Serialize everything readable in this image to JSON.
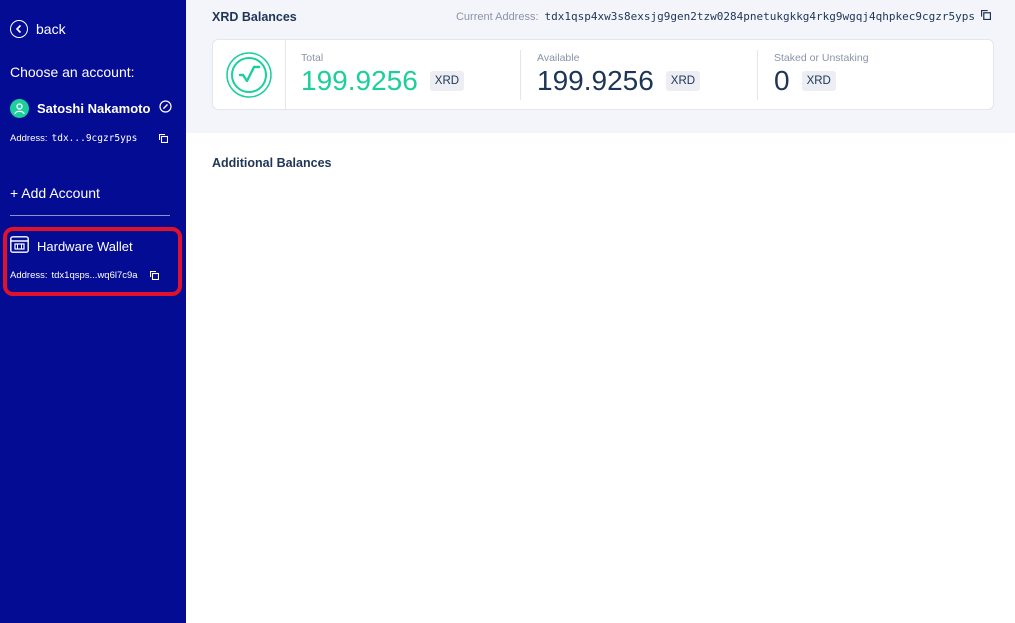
{
  "sidebar": {
    "back_label": "back",
    "choose_label": "Choose an account:",
    "account": {
      "name": "Satoshi Nakamoto",
      "address_label": "Address:",
      "address": "tdx...9cgzr5yps"
    },
    "add_account_label": "+ Add Account",
    "hardware_wallet": {
      "name": "Hardware Wallet",
      "address_label": "Address:",
      "address": "tdx1qsps...wq6l7c9a"
    },
    "colors": {
      "background": "#050c94",
      "accent": "#1ccf9c",
      "highlight": "#e0112b"
    }
  },
  "main": {
    "title": "XRD Balances",
    "current_address_label": "Current Address:",
    "current_address": "tdx1qsp4xw3s8exsjg9gen2tzw0284pnetukgkkg4rkg9wgqj4qhpkec9cgzr5yps",
    "balances": {
      "total_label": "Total",
      "total_value": "199.9256",
      "total_unit": "XRD",
      "available_label": "Available",
      "available_value": "199.9256",
      "available_unit": "XRD",
      "staked_label": "Staked or Unstaking",
      "staked_value": "0",
      "staked_unit": "XRD"
    },
    "additional_title": "Additional Balances"
  }
}
